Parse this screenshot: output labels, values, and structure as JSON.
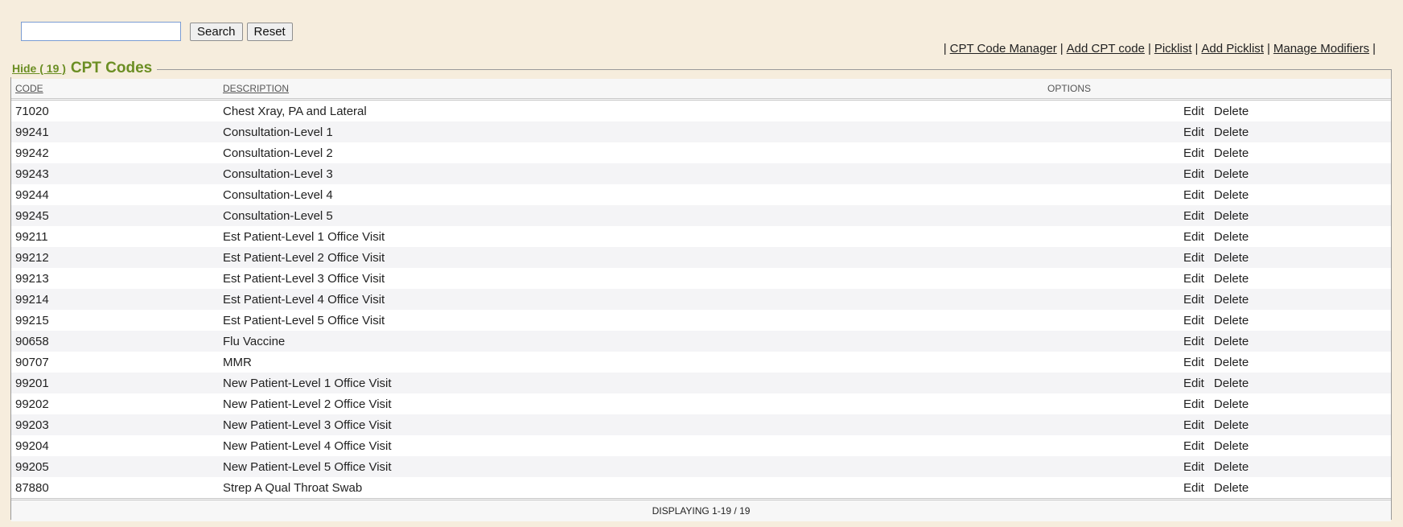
{
  "search": {
    "value": "",
    "placeholder": "",
    "search_label": "Search",
    "reset_label": "Reset"
  },
  "nav": {
    "links": [
      "CPT Code Manager",
      "Add CPT code",
      "Picklist",
      "Add Picklist",
      "Manage Modifiers"
    ],
    "separator": "|"
  },
  "panel": {
    "hide_label": "Hide ( 19 )",
    "title": "CPT Codes"
  },
  "table": {
    "headers": {
      "code": "CODE",
      "description": "DESCRIPTION",
      "options": "OPTIONS"
    },
    "edit_label": "Edit",
    "delete_label": "Delete",
    "rows": [
      {
        "code": "71020",
        "description": "Chest Xray, PA and Lateral"
      },
      {
        "code": "99241",
        "description": "Consultation-Level 1"
      },
      {
        "code": "99242",
        "description": "Consultation-Level 2"
      },
      {
        "code": "99243",
        "description": "Consultation-Level 3"
      },
      {
        "code": "99244",
        "description": "Consultation-Level 4"
      },
      {
        "code": "99245",
        "description": "Consultation-Level 5"
      },
      {
        "code": "99211",
        "description": "Est Patient-Level 1 Office Visit"
      },
      {
        "code": "99212",
        "description": "Est Patient-Level 2 Office Visit"
      },
      {
        "code": "99213",
        "description": "Est Patient-Level 3 Office Visit"
      },
      {
        "code": "99214",
        "description": "Est Patient-Level 4 Office Visit"
      },
      {
        "code": "99215",
        "description": "Est Patient-Level 5 Office Visit"
      },
      {
        "code": "90658",
        "description": "Flu Vaccine"
      },
      {
        "code": "90707",
        "description": "MMR"
      },
      {
        "code": "99201",
        "description": "New Patient-Level 1 Office Visit"
      },
      {
        "code": "99202",
        "description": "New Patient-Level 2 Office Visit"
      },
      {
        "code": "99203",
        "description": "New Patient-Level 3 Office Visit"
      },
      {
        "code": "99204",
        "description": "New Patient-Level 4 Office Visit"
      },
      {
        "code": "99205",
        "description": "New Patient-Level 5 Office Visit"
      },
      {
        "code": "87880",
        "description": "Strep A Qual Throat Swab"
      }
    ],
    "footer": "DISPLAYING 1-19 / 19"
  },
  "colors": {
    "page_bg": "#f6eddd",
    "accent_green": "#6b8e23",
    "row_alt": "#f4f4f6"
  }
}
